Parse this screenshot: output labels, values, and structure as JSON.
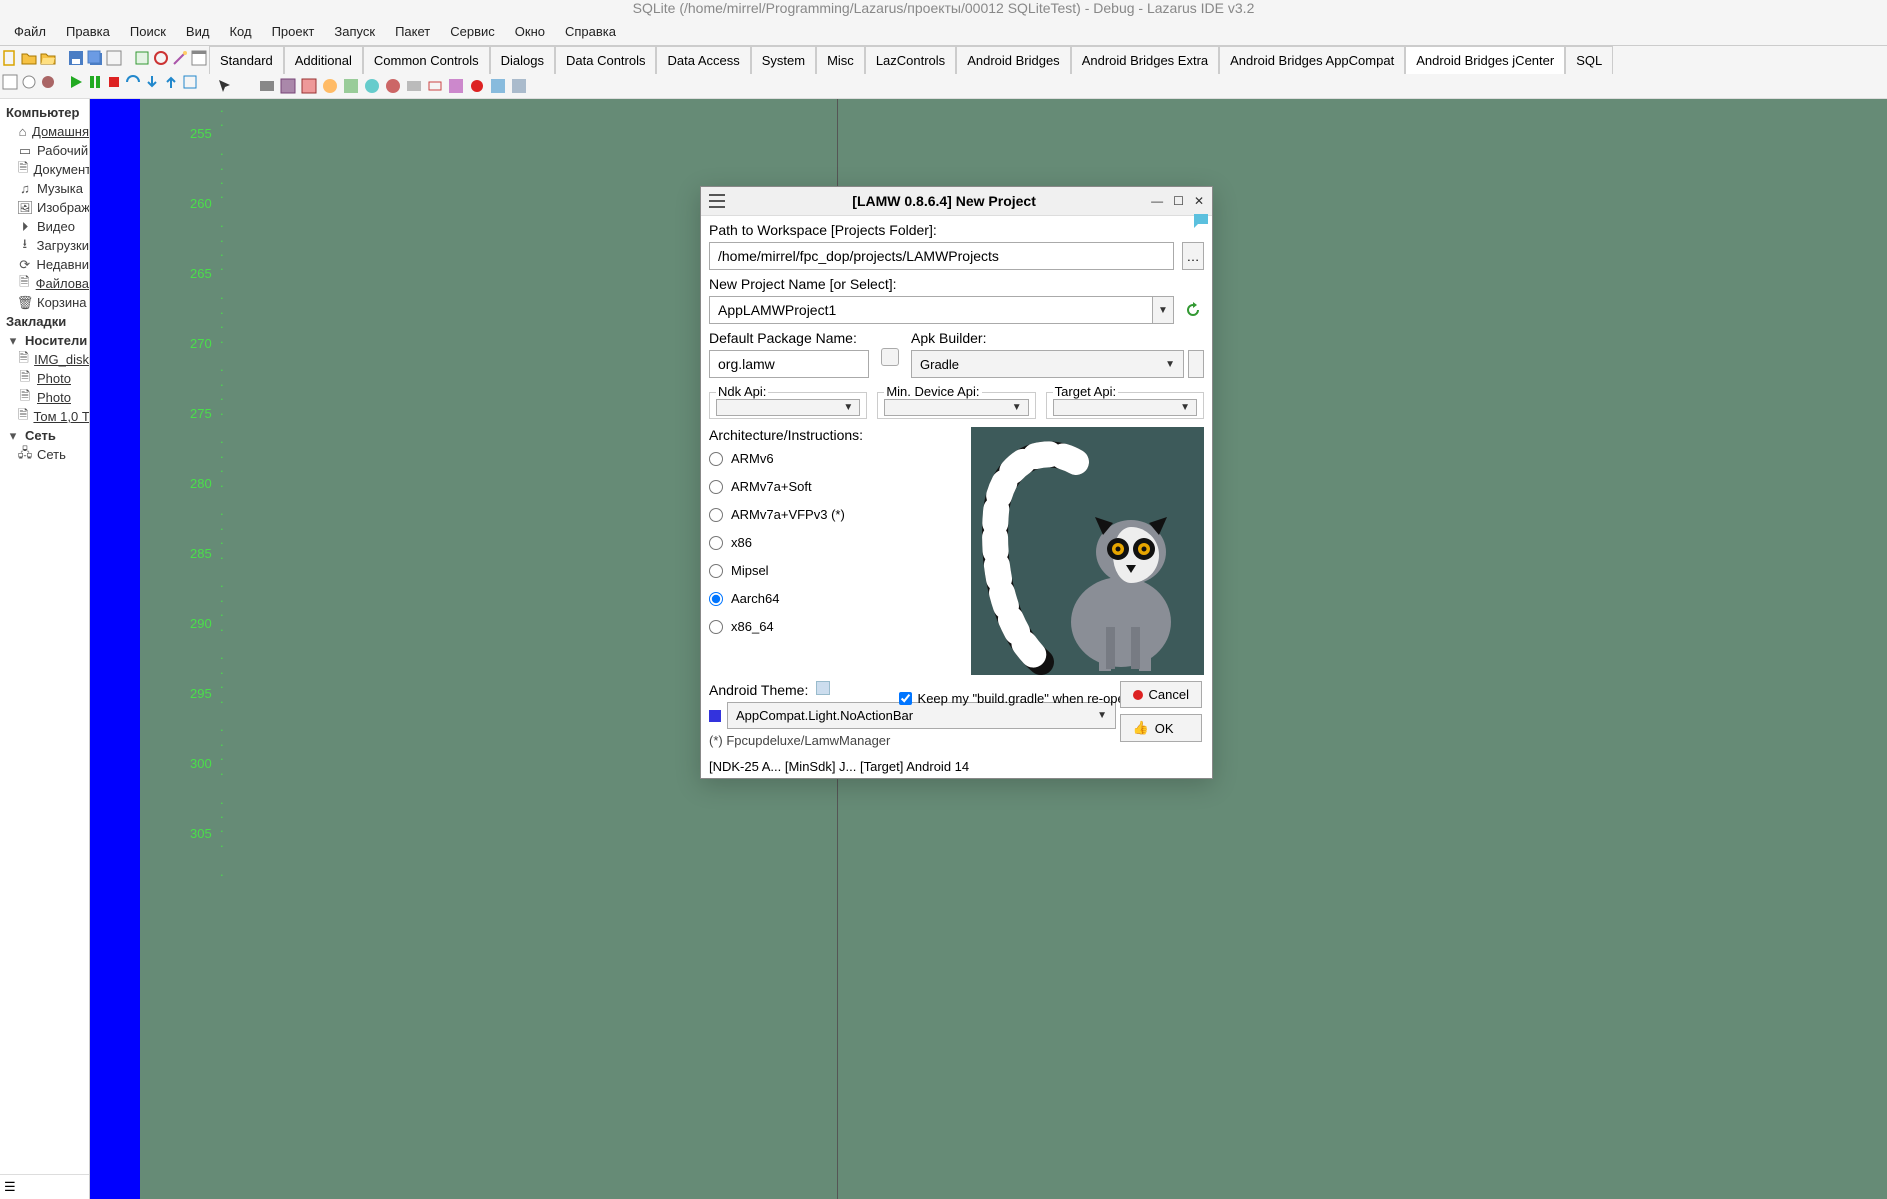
{
  "app_title": "SQLite (/home/mirrel/Programming/Lazarus/проекты/00012 SQLiteTest) - Debug - Lazarus IDE v3.2",
  "menu": [
    "Файл",
    "Правка",
    "Поиск",
    "Вид",
    "Код",
    "Проект",
    "Запуск",
    "Пакет",
    "Сервис",
    "Окно",
    "Справка"
  ],
  "palette_tabs": [
    "Standard",
    "Additional",
    "Common Controls",
    "Dialogs",
    "Data Controls",
    "Data Access",
    "System",
    "Misc",
    "LazControls",
    "Android Bridges",
    "Android Bridges Extra",
    "Android Bridges AppCompat",
    "Android Bridges jCenter",
    "SQL"
  ],
  "palette_active": 12,
  "tree": {
    "heading0": "Компьютер",
    "items0": [
      "Домашня",
      "Рабочий",
      "Документ",
      "Музыка",
      "Изображ",
      "Видео",
      "Загрузки",
      "Недавни",
      "Файлова",
      "Корзина"
    ],
    "heading1": "Закладки",
    "heading2": "Носители",
    "items2": [
      "IMG_disk",
      "Photo",
      "Photo",
      "Том 1,0 Т"
    ],
    "heading3": "Сеть",
    "items3": [
      "Сеть"
    ]
  },
  "line_numbers": [
    "255",
    "260",
    "265",
    "270",
    "275",
    "280",
    "285",
    "290",
    "295",
    "300",
    "305"
  ],
  "dialog": {
    "title": "[LAMW 0.8.6.4]  New Project",
    "path_label": "Path to Workspace [Projects Folder]:",
    "path_value": "/home/mirrel/fpc_dop/projects/LAMWProjects",
    "name_label": "New Project Name  [or Select]:",
    "name_value": "AppLAMWProject1",
    "pkg_label": "Default Package Name:",
    "pkg_value": "org.lamw",
    "apk_builder_label": "Apk Builder:",
    "apk_builder_value": "Gradle",
    "ndk_label": "Ndk Api:",
    "ndk_value": "",
    "mindev_label": "Min. Device Api:",
    "mindev_value": "",
    "target_label": "Target Api:",
    "target_value": "",
    "arch_label": "Architecture/Instructions:",
    "arch_options": [
      "ARMv6",
      "ARMv7a+Soft",
      "ARMv7a+VFPv3  (*)",
      "x86",
      "Mipsel",
      "Aarch64",
      "x86_64"
    ],
    "arch_selected": 5,
    "theme_label": "Android Theme:",
    "theme_value": "AppCompat.Light.NoActionBar",
    "keep_gradle": "Keep my \"build.gradle\" when re-open",
    "keep_gradle_checked": true,
    "btn_cancel": "Cancel",
    "btn_ok": "OK",
    "footnote": "(*) Fpcupdeluxe/LamwManager",
    "status": "[NDK-25 A...   [MinSdk] J...   [Target] Android 14"
  }
}
